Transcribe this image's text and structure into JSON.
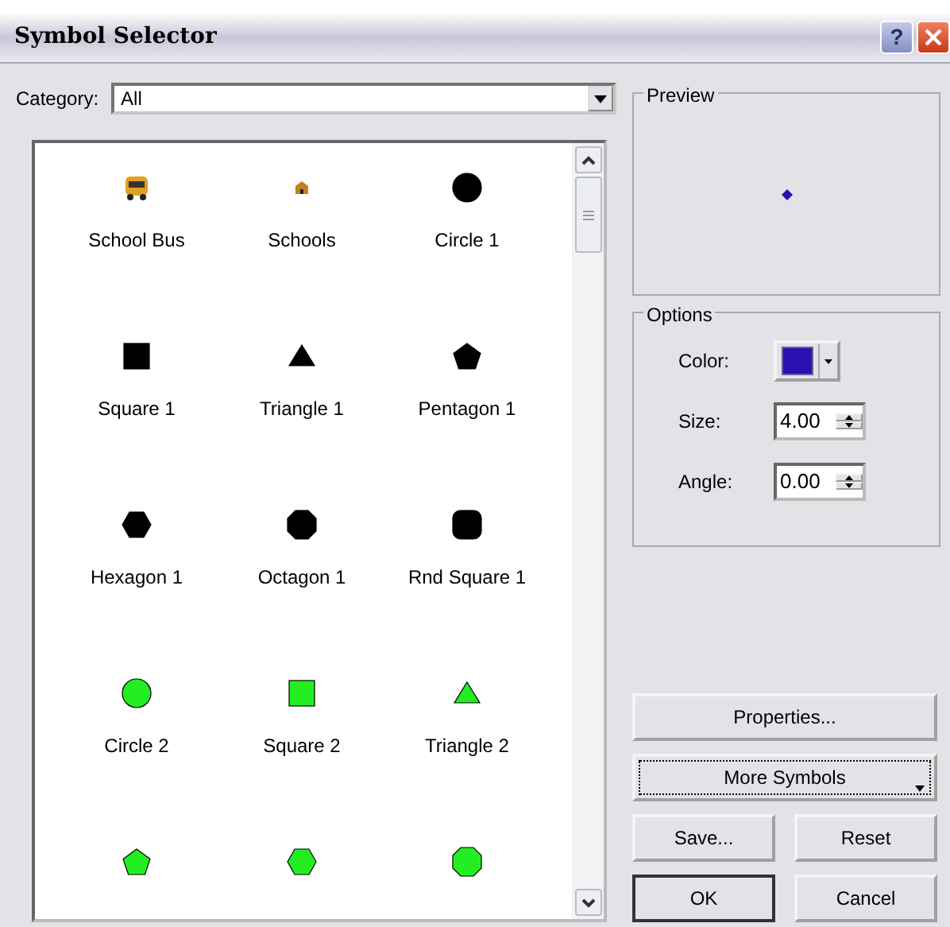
{
  "window": {
    "title": "Symbol Selector",
    "buttons": [
      {
        "kind": "help",
        "label": "?"
      },
      {
        "kind": "close"
      }
    ]
  },
  "category": {
    "label": "Category:",
    "value": "All"
  },
  "symbols": [
    {
      "kind": "bus",
      "color": "#e0a020",
      "label": "School Bus"
    },
    {
      "kind": "school",
      "color": "#c08020",
      "label": "Schools"
    },
    {
      "kind": "circle",
      "color": "#000000",
      "label": "Circle 1"
    },
    {
      "kind": "square",
      "color": "#000000",
      "label": "Square 1"
    },
    {
      "kind": "triangle",
      "color": "#000000",
      "label": "Triangle 1"
    },
    {
      "kind": "pentagon",
      "color": "#000000",
      "label": "Pentagon 1"
    },
    {
      "kind": "hexagon",
      "color": "#000000",
      "label": "Hexagon 1"
    },
    {
      "kind": "octagon",
      "color": "#000000",
      "label": "Octagon 1"
    },
    {
      "kind": "rnd-square",
      "color": "#000000",
      "label": "Rnd Square 1"
    },
    {
      "kind": "circle",
      "color": "#22ee22",
      "label": "Circle 2"
    },
    {
      "kind": "square",
      "color": "#22ee22",
      "label": "Square 2"
    },
    {
      "kind": "triangle",
      "color": "#22ee22",
      "label": "Triangle 2"
    },
    {
      "kind": "pentagon",
      "color": "#22ee22"
    },
    {
      "kind": "hexagon",
      "color": "#22ee22"
    },
    {
      "kind": "octagon",
      "color": "#22ee22"
    }
  ],
  "preview": {
    "title": "Preview"
  },
  "options": {
    "title": "Options",
    "fields": [
      {
        "kind": "color",
        "label": "Color:",
        "color": "#2a10b0"
      },
      {
        "kind": "spin",
        "label": "Size:",
        "value": "4.00"
      },
      {
        "kind": "spin",
        "label": "Angle:",
        "value": "0.00"
      }
    ]
  },
  "buttons": [
    {
      "label": "Properties...",
      "focused": false,
      "dropdown": false,
      "default": false
    },
    {
      "label": "More Symbols",
      "focused": true,
      "dropdown": true,
      "default": false
    },
    {
      "label": "Save...",
      "focused": false,
      "dropdown": false,
      "default": false
    },
    {
      "label": "Reset",
      "focused": false,
      "dropdown": false,
      "default": false
    },
    {
      "label": "OK",
      "focused": false,
      "dropdown": false,
      "default": true
    },
    {
      "label": "Cancel",
      "focused": false,
      "dropdown": false,
      "default": false
    }
  ]
}
